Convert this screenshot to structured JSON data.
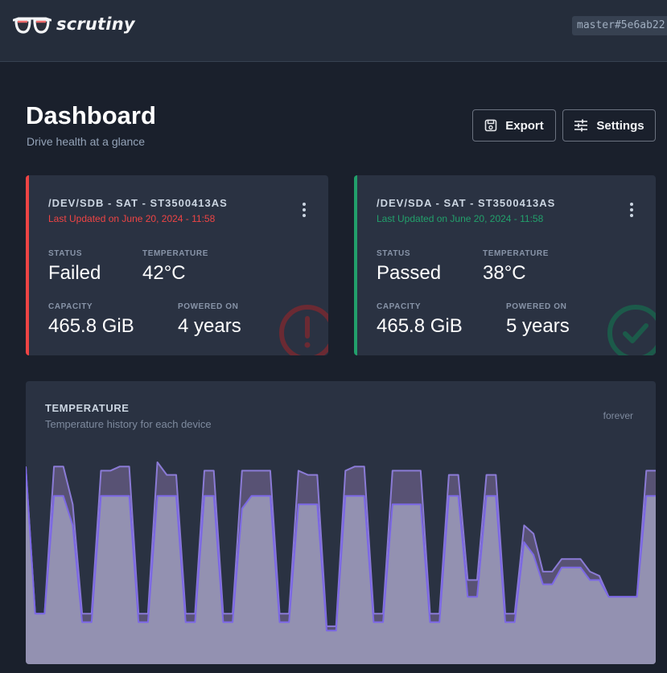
{
  "app": {
    "name": "scrutiny",
    "version": "master#5e6ab22"
  },
  "header": {
    "title": "Dashboard",
    "subtitle": "Drive health at a glance",
    "export_label": "Export",
    "settings_label": "Settings"
  },
  "devices": [
    {
      "title": "/DEV/SDB - SAT - ST3500413AS",
      "updated": "Last Updated on June 20, 2024 - 11:58",
      "status_label": "STATUS",
      "status": "Failed",
      "temperature_label": "TEMPERATURE",
      "temperature": "42°C",
      "capacity_label": "CAPACITY",
      "capacity": "465.8 GiB",
      "powered_on_label": "POWERED ON",
      "powered_on": "4 years",
      "accent_color": "#ef4444",
      "icon": "exclamation-circle-icon"
    },
    {
      "title": "/DEV/SDA - SAT - ST3500413AS",
      "updated": "Last Updated on June 20, 2024 - 11:58",
      "status_label": "STATUS",
      "status": "Passed",
      "temperature_label": "TEMPERATURE",
      "temperature": "38°C",
      "capacity_label": "CAPACITY",
      "capacity": "465.8 GiB",
      "powered_on_label": "POWERED ON",
      "powered_on": "5 years",
      "accent_color": "#22a06b",
      "icon": "check-circle-icon"
    }
  ],
  "temperature_panel": {
    "title": "TEMPERATURE",
    "subtitle": "Temperature history for each device",
    "range": "forever"
  },
  "chart_data": {
    "type": "area",
    "ylim": [
      0,
      52
    ],
    "series": [
      {
        "color": "#8b7bd6",
        "values": [
          47,
          12,
          12,
          47,
          47,
          38,
          12,
          12,
          46,
          46,
          47,
          47,
          12,
          12,
          48,
          45,
          45,
          12,
          12,
          46,
          46,
          12,
          12,
          46,
          46,
          46,
          46,
          12,
          12,
          46,
          45,
          45,
          9,
          9,
          46,
          47,
          47,
          12,
          12,
          46,
          46,
          46,
          46,
          12,
          12,
          45,
          45,
          20,
          20,
          45,
          45,
          12,
          12,
          33,
          31,
          22,
          22,
          25,
          25,
          25,
          22,
          21,
          16,
          16,
          16,
          16,
          46,
          46
        ]
      },
      {
        "color": "#7c68e6",
        "values": [
          47,
          12,
          12,
          40,
          40,
          33,
          10,
          10,
          40,
          40,
          40,
          40,
          10,
          10,
          40,
          40,
          40,
          10,
          10,
          40,
          40,
          10,
          10,
          37,
          40,
          40,
          40,
          10,
          10,
          38,
          38,
          38,
          8,
          8,
          40,
          40,
          40,
          10,
          10,
          38,
          38,
          38,
          38,
          10,
          10,
          40,
          40,
          16,
          16,
          40,
          40,
          10,
          10,
          29,
          26,
          19,
          19,
          23,
          23,
          23,
          20,
          20,
          16,
          16,
          16,
          16,
          40,
          40
        ]
      }
    ]
  }
}
